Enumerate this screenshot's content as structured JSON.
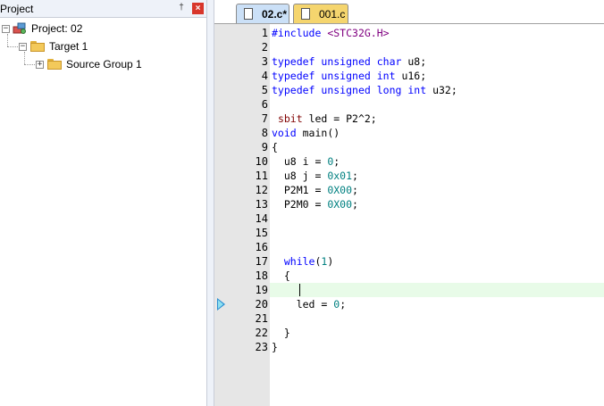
{
  "project_panel": {
    "title": "Project",
    "pin_label": "†",
    "close_label": "×",
    "tree": {
      "project": "Project: 02",
      "target": "Target 1",
      "group": "Source Group 1"
    },
    "expander_minus": "−",
    "expander_plus": "+"
  },
  "tabs": [
    {
      "label": "02.c*",
      "active": true
    },
    {
      "label": "001.c",
      "active": false
    }
  ],
  "editor": {
    "current_line": 19,
    "breakpoint_line": 20,
    "lines": [
      {
        "n": "1",
        "html": "<span class=\"kw\">#include</span> <span class=\"str\">&lt;STC32G.H&gt;</span>"
      },
      {
        "n": "2",
        "html": ""
      },
      {
        "n": "3",
        "html": "<span class=\"kw\">typedef</span> <span class=\"kw\">unsigned</span> <span class=\"kw\">char</span> u8;"
      },
      {
        "n": "4",
        "html": "<span class=\"kw\">typedef</span> <span class=\"kw\">unsigned</span> <span class=\"kw\">int</span> u16;"
      },
      {
        "n": "5",
        "html": "<span class=\"kw\">typedef</span> <span class=\"kw\">unsigned</span> <span class=\"kw\">long</span> <span class=\"kw\">int</span> u32;"
      },
      {
        "n": "6",
        "html": ""
      },
      {
        "n": "7",
        "html": " <span class=\"red\">sbit</span> led = P2^2;"
      },
      {
        "n": "8",
        "html": "<span class=\"kw\">void</span> main()"
      },
      {
        "n": "9",
        "html": "{"
      },
      {
        "n": "10",
        "html": "  u8 i = <span class=\"num\">0</span>;"
      },
      {
        "n": "11",
        "html": "  u8 j = <span class=\"num\">0x01</span>;"
      },
      {
        "n": "12",
        "html": "  P2M1 = <span class=\"num\">0X00</span>;"
      },
      {
        "n": "13",
        "html": "  P2M0 = <span class=\"num\">0X00</span>;"
      },
      {
        "n": "14",
        "html": ""
      },
      {
        "n": "15",
        "html": ""
      },
      {
        "n": "16",
        "html": ""
      },
      {
        "n": "17",
        "html": "  <span class=\"kw\">while</span>(<span class=\"num\">1</span>)"
      },
      {
        "n": "18",
        "html": "  {"
      },
      {
        "n": "19",
        "html": ""
      },
      {
        "n": "20",
        "html": "    led = <span class=\"num\">0</span>;"
      },
      {
        "n": "21",
        "html": ""
      },
      {
        "n": "22",
        "html": "  }"
      },
      {
        "n": "23",
        "html": "}"
      }
    ]
  }
}
